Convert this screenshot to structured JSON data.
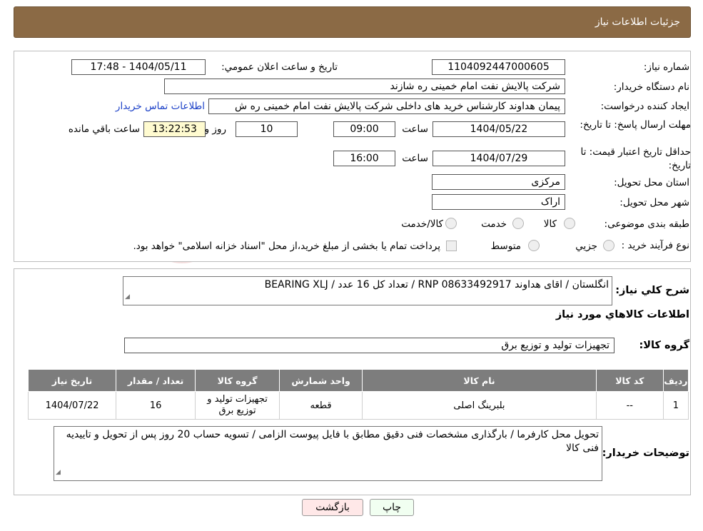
{
  "header": {
    "title": "جزئیات اطلاعات نیاز"
  },
  "form": {
    "need_number_label": "شماره نیاز:",
    "need_number": "1104092447000605",
    "announce_label": "تاریخ و ساعت اعلان عمومي:",
    "announce_value": "1404/05/11 - 17:48",
    "buyer_org_label": "نام دستگاه خريدار:",
    "buyer_org": "شرکت پالایش نفت امام خمینی  ره  شازند",
    "creator_label": "ايجاد کننده درخواست:",
    "creator": "پیمان هداوند کارشناس خرید های داخلی  شرکت پالایش نفت امام خمینی  ره  ش",
    "contact_link": "اطلاعات تماس خريدار",
    "deadline_label": "مهلت ارسال پاسخ: تا تاريخ:",
    "deadline_date": "1404/05/22",
    "time_label": "ساعت",
    "deadline_time": "09:00",
    "days_value": "10",
    "days_label": "روز و",
    "remaining_time": "13:22:53",
    "remaining_label": "ساعت باقي مانده",
    "validity_label": "حداقل تاريخ اعتبار قيمت: تا تاريخ:",
    "validity_date": "1404/07/29",
    "validity_time": "16:00",
    "province_label": "استان محل تحويل:",
    "province": "مرکزی",
    "city_label": "شهر محل تحويل:",
    "city": "اراک",
    "category_label": "طبقه بندی موضوعی:",
    "category_options": [
      "کالا",
      "خدمت",
      "کالا/خدمت"
    ],
    "process_label": "نوع فرآيند خريد :",
    "process_options": [
      "جزيي",
      "متوسط"
    ],
    "process_note": "پرداخت تمام یا بخشی از مبلغ خرید،از محل \"اسناد خزانه اسلامی\" خواهد بود."
  },
  "summary": {
    "label": "شرح کلي نياز:",
    "text": "BEARING XLJ / تعداد کل 16 عدد / RNP انگلستان / اقای هداوند  08633492917",
    "goods_info_title": "اطلاعات کالاهاي مورد نياز",
    "goods_group_label": "گروه کالا:",
    "goods_group": "تجهیزات تولید و توزیع برق"
  },
  "table": {
    "headers": [
      "رديف",
      "کد کالا",
      "نام کالا",
      "واحد شمارش",
      "گروه کالا",
      "تعداد / مقدار",
      "تاريخ نياز"
    ],
    "rows": [
      {
        "index": "1",
        "code": "--",
        "name": "بلبرینگ اصلی",
        "unit": "قطعه",
        "group": "تجهیزات تولید و توزیع برق",
        "qty": "16",
        "date": "1404/07/22"
      }
    ]
  },
  "notes": {
    "label": "توضيحات خريدار:",
    "text": "تحویل محل کارفرما / بارگذاری مشخصات فنی دقیق مطابق با فایل پیوست الزامی / تسویه حساب 20 روز پس از تحویل و تاییدیه فنی کالا"
  },
  "buttons": {
    "print": "چاپ",
    "back": "بازگشت"
  },
  "watermark_text": "AriaTender.neT"
}
